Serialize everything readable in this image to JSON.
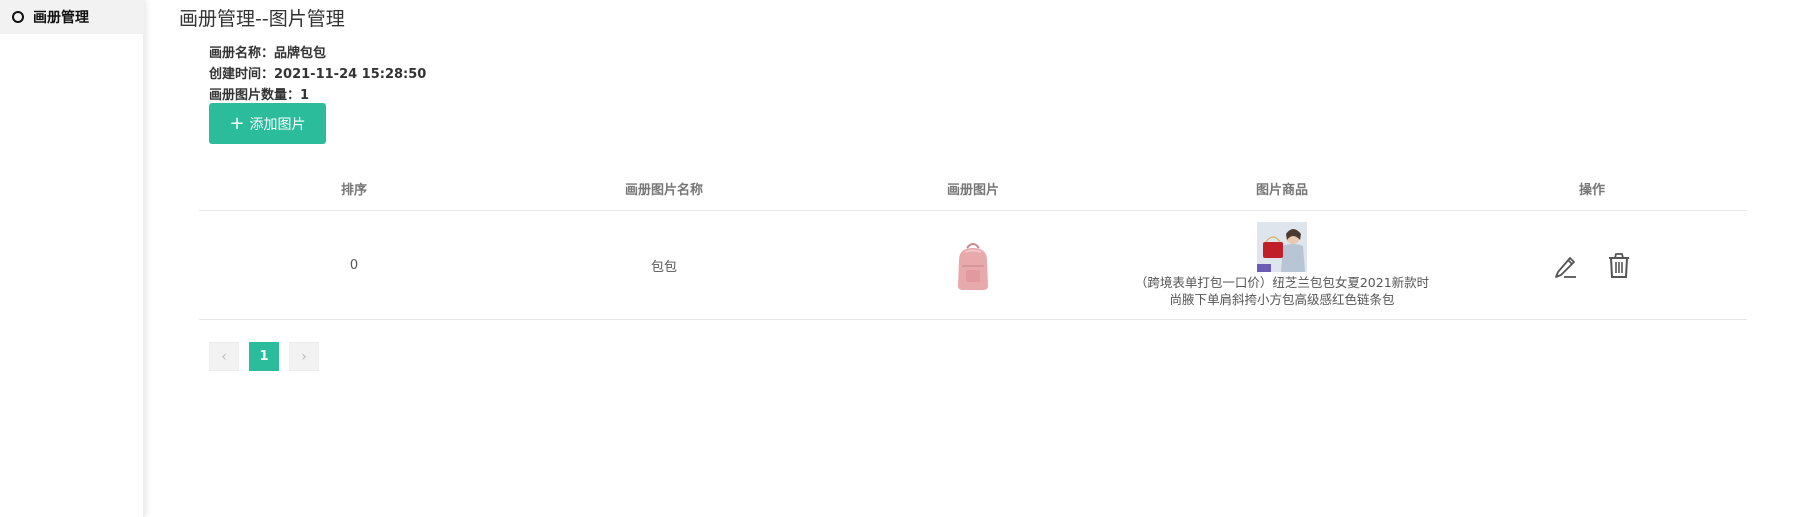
{
  "sidebar": {
    "items": [
      {
        "label": "画册管理",
        "icon": "circle-outline-icon"
      }
    ]
  },
  "page": {
    "title": "画册管理--图片管理"
  },
  "album": {
    "name_line": "画册名称：品牌包包",
    "created_line": "创建时间：2021-11-24 15:28:50",
    "count_line": "画册图片数量：1"
  },
  "toolbar": {
    "add_label": "添加图片",
    "add_icon": "plus-icon"
  },
  "table": {
    "headers": [
      "排序",
      "画册图片名称",
      "画册图片",
      "图片商品",
      "操作"
    ],
    "rows": [
      {
        "sort": "0",
        "name": "包包",
        "image": "pink-backpack-image",
        "product_name": "（跨境表单打包一口价）纽芝兰包包女夏2021新款时尚腋下单肩斜挎小方包高级感红色链条包",
        "product_image": "red-handbag-model-image",
        "actions": [
          "edit-icon",
          "delete-icon"
        ]
      }
    ]
  },
  "pagination": {
    "prev": "‹",
    "current": "1",
    "next": "›"
  },
  "colors": {
    "accent": "#2bbd9b",
    "sidebar_active_bg": "#f2f2f2"
  }
}
